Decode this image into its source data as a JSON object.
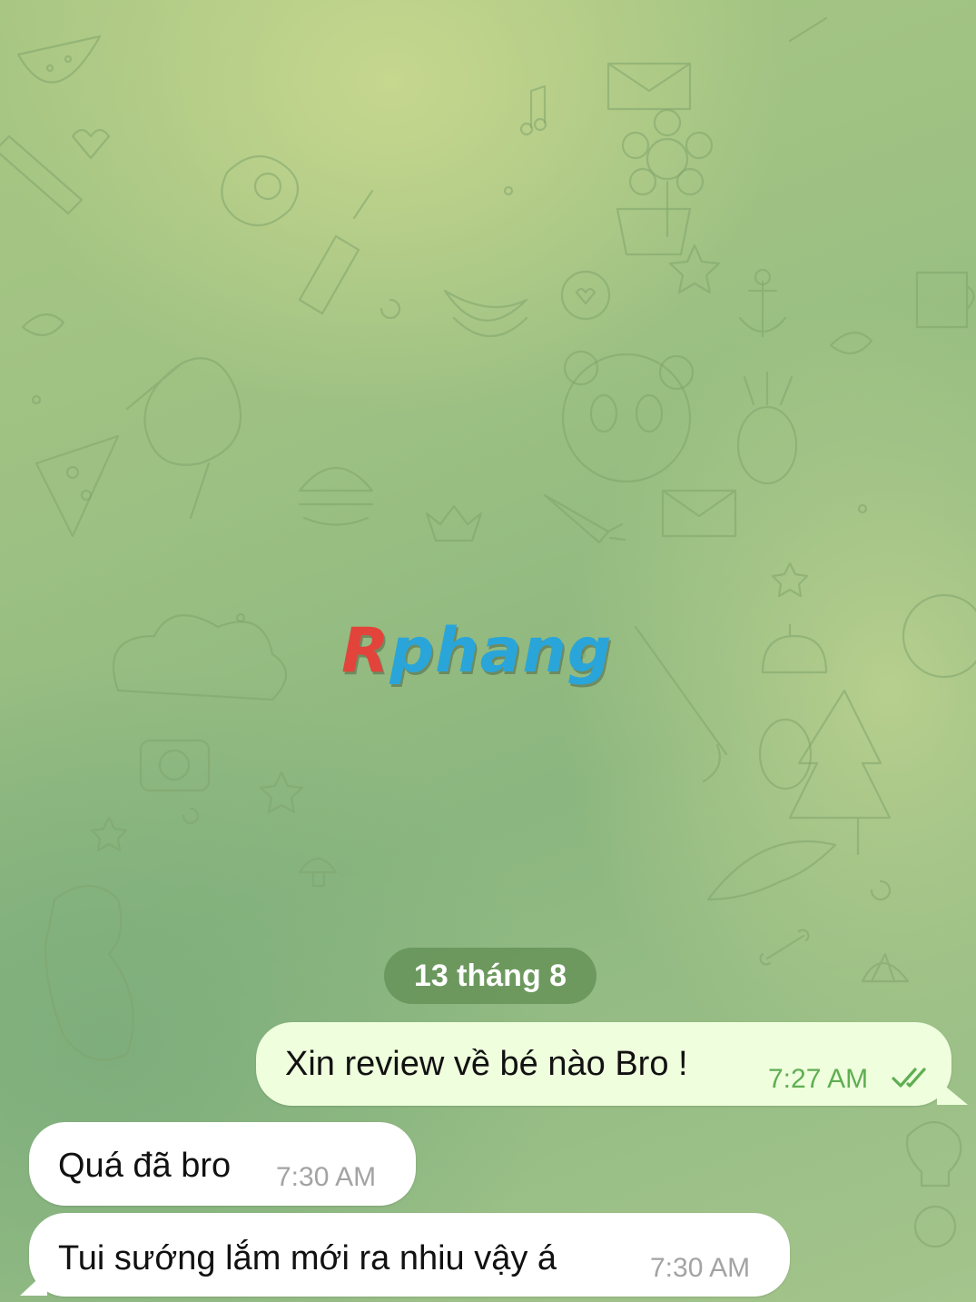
{
  "logo": {
    "first_letter": "R",
    "rest": "phang"
  },
  "chat": {
    "date_separator": "13 tháng 8",
    "messages": [
      {
        "direction": "outgoing",
        "text": "Xin review về bé nào Bro !",
        "time": "7:27 AM",
        "status": "read"
      },
      {
        "direction": "incoming",
        "text": "Quá đã bro",
        "time": "7:30 AM"
      },
      {
        "direction": "incoming",
        "text": "Tui sướng lắm mới ra nhiu vậy á",
        "time": "7:30 AM"
      }
    ]
  },
  "colors": {
    "outgoing_bubble": "#effedd",
    "incoming_bubble": "#ffffff",
    "outgoing_time": "#5fae53",
    "incoming_time": "#a3a3a3",
    "date_pill": "#638f54",
    "logo_red": "#e2433b",
    "logo_blue": "#2aa5d9"
  },
  "icons": {
    "read_status": "double-check-icon",
    "wallpaper": "doodle-pattern"
  }
}
